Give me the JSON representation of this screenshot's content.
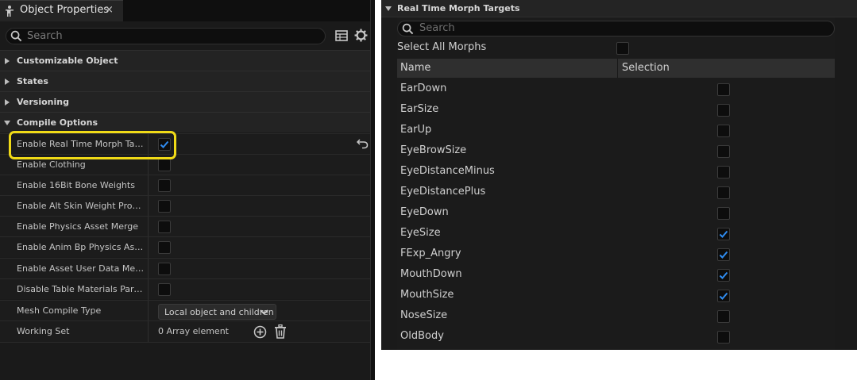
{
  "left_panel": {
    "tab": {
      "title": "Object Properties",
      "close_glyph": "×",
      "icon": "actor-icon"
    },
    "search": {
      "placeholder": "Search"
    },
    "categories": [
      {
        "label": "Customizable Object",
        "expanded": false
      },
      {
        "label": "States",
        "expanded": false
      },
      {
        "label": "Versioning",
        "expanded": false
      },
      {
        "label": "Compile Options",
        "expanded": true
      }
    ],
    "properties": [
      {
        "label": "Enable Real Time Morph Targets",
        "checked": true,
        "highlighted": true
      },
      {
        "label": "Enable Clothing",
        "checked": false
      },
      {
        "label": "Enable 16Bit Bone Weights",
        "checked": false
      },
      {
        "label": "Enable Alt Skin Weight Profiles",
        "checked": false
      },
      {
        "label": "Enable Physics Asset Merge",
        "checked": false
      },
      {
        "label": "Enable Anim Bp Physics Assets M...",
        "checked": false
      },
      {
        "label": "Enable Asset User Data Merge",
        "checked": false
      },
      {
        "label": "Disable Table Materials Parent Ch...",
        "checked": false
      }
    ],
    "mesh_compile_type": {
      "label": "Mesh Compile Type",
      "value": "Local object and children"
    },
    "working_set": {
      "label": "Working Set",
      "value": "0 Array element"
    }
  },
  "right_panel": {
    "header": "Real Time Morph Targets",
    "search": {
      "placeholder": "Search"
    },
    "select_all_label": "Select All Morphs",
    "select_all_checked": false,
    "columns": [
      "Name",
      "Selection"
    ],
    "morphs": [
      {
        "name": "EarDown",
        "selected": false
      },
      {
        "name": "EarSize",
        "selected": false
      },
      {
        "name": "EarUp",
        "selected": false
      },
      {
        "name": "EyeBrowSize",
        "selected": false
      },
      {
        "name": "EyeDistanceMinus",
        "selected": false
      },
      {
        "name": "EyeDistancePlus",
        "selected": false
      },
      {
        "name": "EyeDown",
        "selected": false
      },
      {
        "name": "EyeSize",
        "selected": true
      },
      {
        "name": "FExp_Angry",
        "selected": true
      },
      {
        "name": "MouthDown",
        "selected": true
      },
      {
        "name": "MouthSize",
        "selected": true
      },
      {
        "name": "NoseSize",
        "selected": false
      },
      {
        "name": "OldBody",
        "selected": false
      }
    ]
  },
  "colors": {
    "checkmark": "#2f8cf0",
    "highlight": "#f0da17",
    "panel_bg": "#1a1a1a"
  }
}
